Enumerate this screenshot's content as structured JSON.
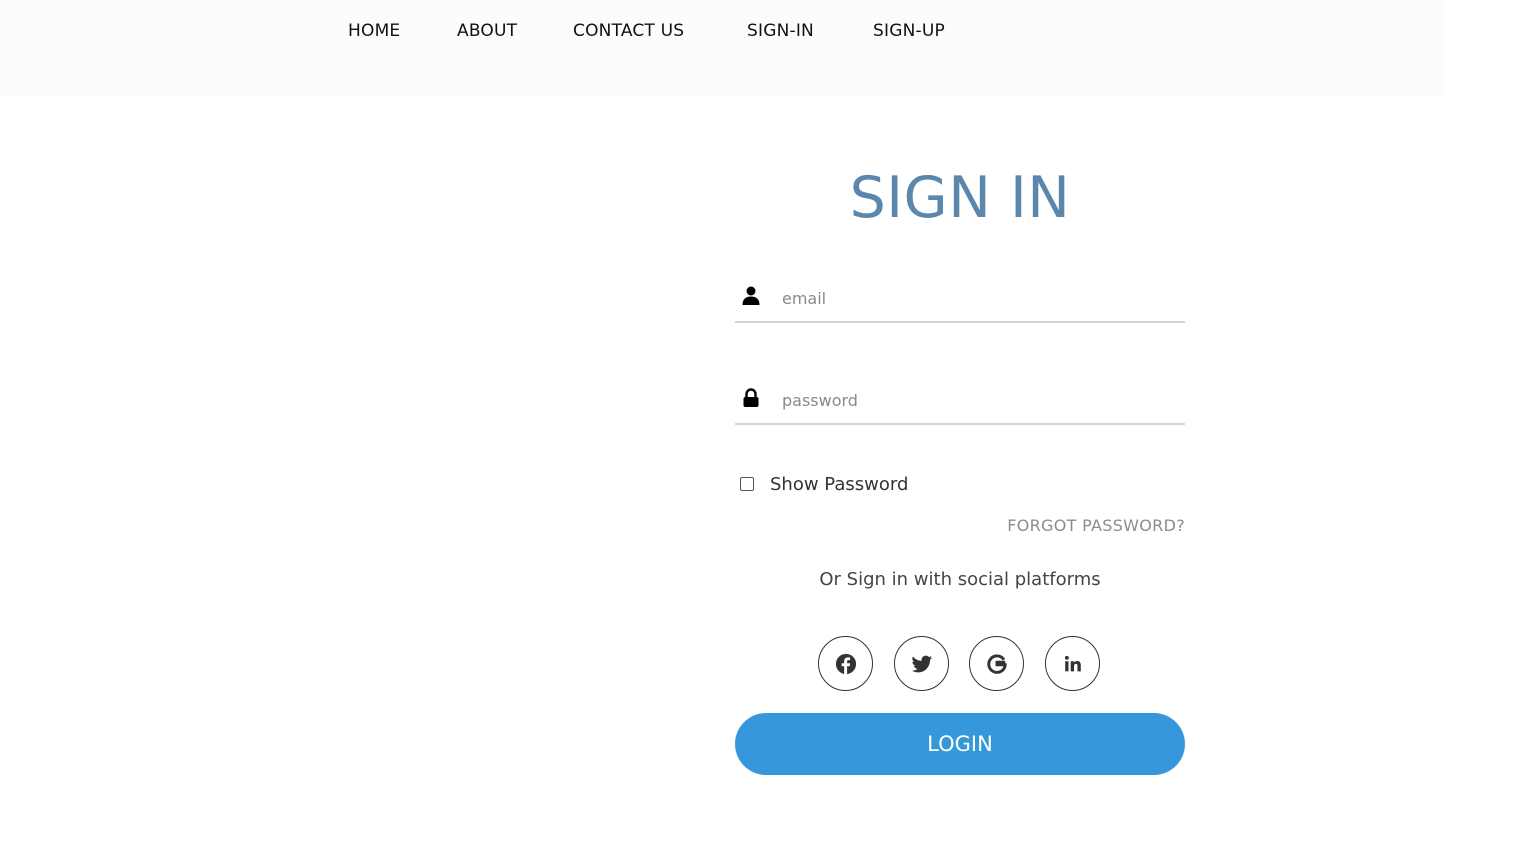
{
  "nav": {
    "items": [
      {
        "label": "HOME"
      },
      {
        "label": "ABOUT"
      },
      {
        "label": "CONTACT US"
      },
      {
        "label": "SIGN-IN"
      },
      {
        "label": "SIGN-UP"
      }
    ]
  },
  "form": {
    "title": "SIGN IN",
    "email": {
      "placeholder": "email",
      "value": "",
      "icon": "user-icon"
    },
    "password": {
      "placeholder": "password",
      "value": "",
      "icon": "lock-icon"
    },
    "show_password": {
      "label": "Show Password",
      "checked": false
    },
    "forgot_label": "FORGOT PASSWORD?",
    "social_text": "Or Sign in with social platforms",
    "social": [
      {
        "icon": "facebook-icon"
      },
      {
        "icon": "twitter-icon"
      },
      {
        "icon": "google-icon"
      },
      {
        "icon": "linkedin-icon"
      }
    ],
    "login_label": "LOGIN"
  },
  "colors": {
    "title": "#5b87ad",
    "login_button": "#3498db",
    "nav_background": "#fcfcfc"
  }
}
